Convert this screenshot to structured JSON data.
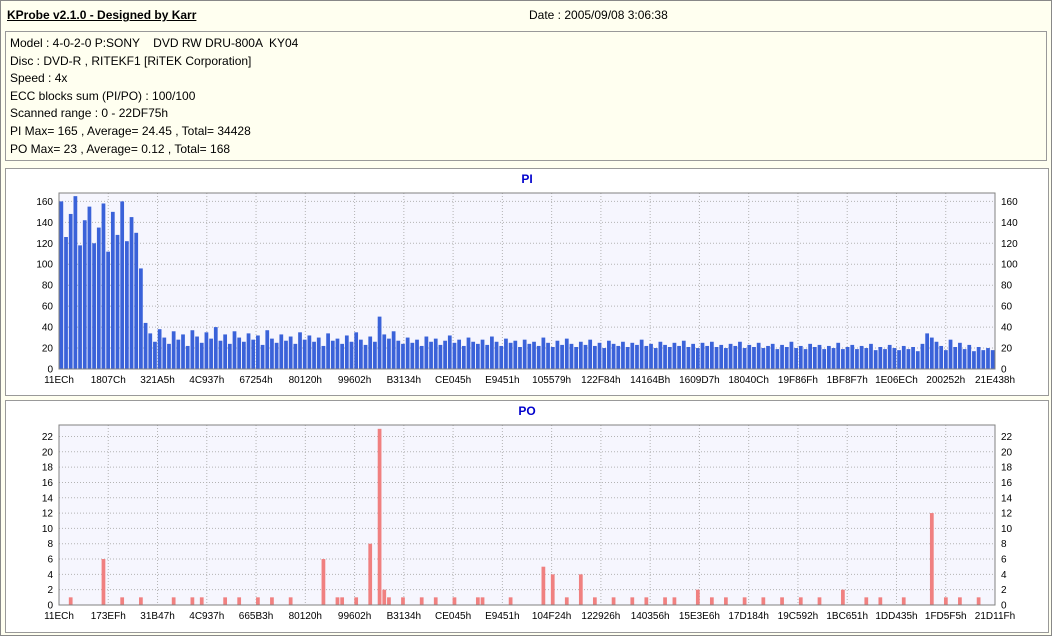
{
  "window": {
    "title": "KProbe v2.1.0 - Designed by Karr",
    "date": "Date : 2005/09/08 3:06:38"
  },
  "info": {
    "lines": [
      "Model : 4-0-2-0 P:SONY    DVD RW DRU-800A  KY04",
      "Disc : DVD-R , RITEKF1 [RiTEK Corporation]",
      "Speed : 4x",
      "ECC blocks sum (PI/PO) : 100/100",
      "Scanned range : 0 - 22DF75h",
      "PI Max= 165 , Average= 24.45 , Total= 34428",
      "PO Max= 23 , Average= 0.12 , Total= 168"
    ]
  },
  "chart_data": [
    {
      "type": "bar",
      "title": "PI",
      "xlabel": "",
      "ylabel": "",
      "x_labels": [
        "11ECh",
        "1807Ch",
        "321A5h",
        "4C937h",
        "67254h",
        "80120h",
        "99602h",
        "B3134h",
        "CE045h",
        "E9451h",
        "105579h",
        "122F84h",
        "14164Bh",
        "1609D7h",
        "18040Ch",
        "19F86Fh",
        "1BF8F7h",
        "1E06ECh",
        "200252h",
        "21E438h"
      ],
      "ylim": [
        0,
        168
      ],
      "ymax": 168,
      "ytick_max": 160,
      "ytick_step": 20,
      "grid": true,
      "bar_color": "#3a62d9",
      "plot_bg": "#f6f6fe",
      "grid_color": "#b4b4b4",
      "values": [
        160,
        126,
        148,
        165,
        118,
        142,
        155,
        120,
        135,
        158,
        112,
        150,
        128,
        160,
        122,
        145,
        130,
        96,
        44,
        34,
        26,
        38,
        30,
        24,
        36,
        28,
        33,
        22,
        37,
        31,
        25,
        35,
        29,
        40,
        27,
        33,
        24,
        36,
        30,
        26,
        34,
        28,
        32,
        23,
        37,
        29,
        25,
        33,
        27,
        31,
        24,
        35,
        28,
        32,
        26,
        30,
        22,
        34,
        27,
        29,
        24,
        32,
        26,
        35,
        28,
        23,
        31,
        26,
        50,
        33,
        29,
        36,
        27,
        24,
        30,
        25,
        28,
        22,
        31,
        26,
        29,
        23,
        27,
        32,
        25,
        28,
        22,
        30,
        26,
        24,
        28,
        23,
        31,
        26,
        22,
        29,
        25,
        27,
        21,
        28,
        24,
        26,
        22,
        30,
        25,
        21,
        27,
        23,
        29,
        24,
        21,
        26,
        23,
        28,
        22,
        25,
        20,
        27,
        24,
        22,
        26,
        21,
        25,
        23,
        28,
        22,
        24,
        20,
        26,
        23,
        21,
        25,
        22,
        27,
        21,
        24,
        20,
        25,
        22,
        26,
        21,
        23,
        20,
        24,
        22,
        26,
        20,
        23,
        21,
        25,
        20,
        22,
        24,
        19,
        23,
        21,
        26,
        20,
        22,
        19,
        24,
        21,
        23,
        19,
        22,
        20,
        25,
        19,
        21,
        23,
        19,
        22,
        20,
        24,
        18,
        21,
        19,
        23,
        20,
        18,
        22,
        19,
        21,
        17,
        24,
        34,
        30,
        26,
        22,
        18,
        28,
        21,
        25,
        19,
        23,
        17,
        21,
        18,
        20,
        18
      ]
    },
    {
      "type": "bar",
      "title": "PO",
      "xlabel": "",
      "ylabel": "",
      "x_labels": [
        "11ECh",
        "173EFh",
        "31B47h",
        "4C937h",
        "665B3h",
        "80120h",
        "99602h",
        "B3134h",
        "CE045h",
        "E9451h",
        "104F24h",
        "122926h",
        "140356h",
        "15E3E6h",
        "17D184h",
        "19C592h",
        "1BC651h",
        "1DD435h",
        "1FD5F5h",
        "21D11Fh"
      ],
      "ylim": [
        0,
        23.5
      ],
      "ymax": 23.5,
      "ytick_max": 22,
      "ytick_step": 2,
      "grid": true,
      "bar_color": "#f08080",
      "plot_bg": "#f6f6fe",
      "grid_color": "#b4b4b4",
      "values": [
        0,
        0,
        1,
        0,
        0,
        0,
        0,
        0,
        0,
        6,
        0,
        0,
        0,
        1,
        0,
        0,
        0,
        1,
        0,
        0,
        0,
        0,
        0,
        0,
        1,
        0,
        0,
        0,
        1,
        0,
        1,
        0,
        0,
        0,
        0,
        1,
        0,
        0,
        1,
        0,
        0,
        0,
        1,
        0,
        0,
        1,
        0,
        0,
        0,
        1,
        0,
        0,
        0,
        0,
        0,
        0,
        6,
        0,
        0,
        1,
        1,
        0,
        0,
        1,
        0,
        0,
        8,
        0,
        23,
        2,
        1,
        0,
        0,
        1,
        0,
        0,
        0,
        1,
        0,
        0,
        1,
        0,
        0,
        0,
        1,
        0,
        0,
        0,
        0,
        1,
        1,
        0,
        0,
        0,
        0,
        0,
        1,
        0,
        0,
        0,
        0,
        0,
        0,
        5,
        0,
        4,
        0,
        0,
        1,
        0,
        0,
        4,
        0,
        0,
        1,
        0,
        0,
        0,
        1,
        0,
        0,
        0,
        1,
        0,
        0,
        1,
        0,
        0,
        0,
        1,
        0,
        1,
        0,
        0,
        0,
        0,
        2,
        0,
        0,
        1,
        0,
        0,
        1,
        0,
        0,
        0,
        1,
        0,
        0,
        0,
        1,
        0,
        0,
        0,
        1,
        0,
        0,
        0,
        1,
        0,
        0,
        0,
        1,
        0,
        0,
        0,
        0,
        2,
        0,
        0,
        0,
        0,
        1,
        0,
        0,
        1,
        0,
        0,
        0,
        0,
        1,
        0,
        0,
        0,
        0,
        0,
        12,
        0,
        0,
        1,
        0,
        0,
        1,
        0,
        0,
        0,
        1,
        0,
        0,
        0
      ]
    }
  ]
}
